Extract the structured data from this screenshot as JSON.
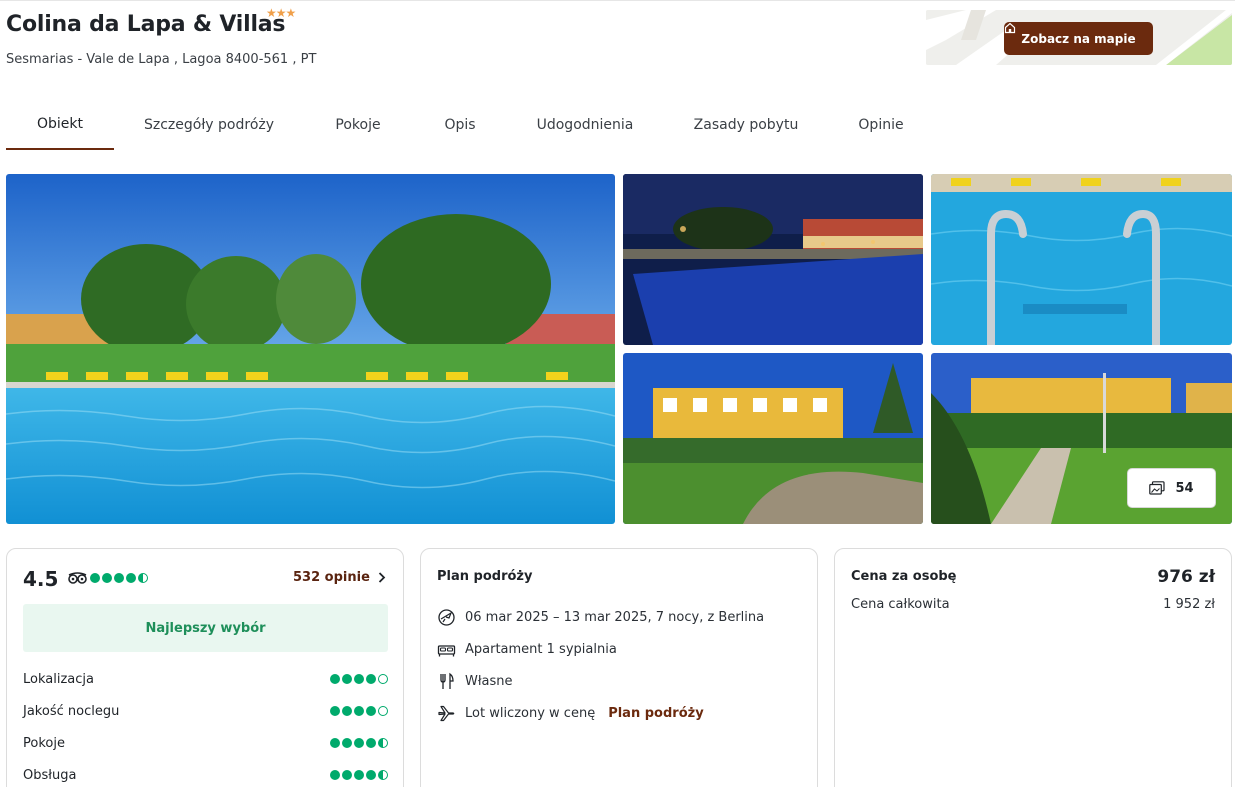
{
  "hotel": {
    "name": "Colina da Lapa & Villas",
    "stars": "★★★",
    "address": "Sesmarias - Vale de Lapa , Lagoa 8400-561 , PT"
  },
  "map": {
    "button_label": "Zobacz na mapie"
  },
  "tabs": [
    {
      "label": "Obiekt"
    },
    {
      "label": "Szczegóły podróży"
    },
    {
      "label": "Pokoje"
    },
    {
      "label": "Opis"
    },
    {
      "label": "Udogodnienia"
    },
    {
      "label": "Zasady pobytu"
    },
    {
      "label": "Opinie"
    }
  ],
  "gallery": {
    "photo_count": "54"
  },
  "rating": {
    "score": "4.5",
    "overall_bubbles": 4.5,
    "reviews_label": "532 opinie",
    "badge": "Najlepszy wybór",
    "criteria": [
      {
        "label": "Lokalizacja",
        "bubbles": 4
      },
      {
        "label": "Jakość noclegu",
        "bubbles": 4
      },
      {
        "label": "Pokoje",
        "bubbles": 4.5
      },
      {
        "label": "Obsługa",
        "bubbles": 4.5
      }
    ]
  },
  "plan": {
    "title": "Plan podróży",
    "dates": "06 mar 2025 – 13 mar 2025, 7 nocy, z Berlina",
    "room": "Apartament 1 sypialnia",
    "board": "Własne",
    "flight": "Lot wliczony w cenę",
    "flight_link": "Plan podróży"
  },
  "price": {
    "per_person_label": "Cena za osobę",
    "per_person_value": "976 zł",
    "total_label": "Cena całkowita",
    "total_value": "1 952 zł"
  },
  "colors": {
    "brand": "#6b2a0e",
    "rating_green": "#00aa6c",
    "star_orange": "#f0a04b"
  }
}
